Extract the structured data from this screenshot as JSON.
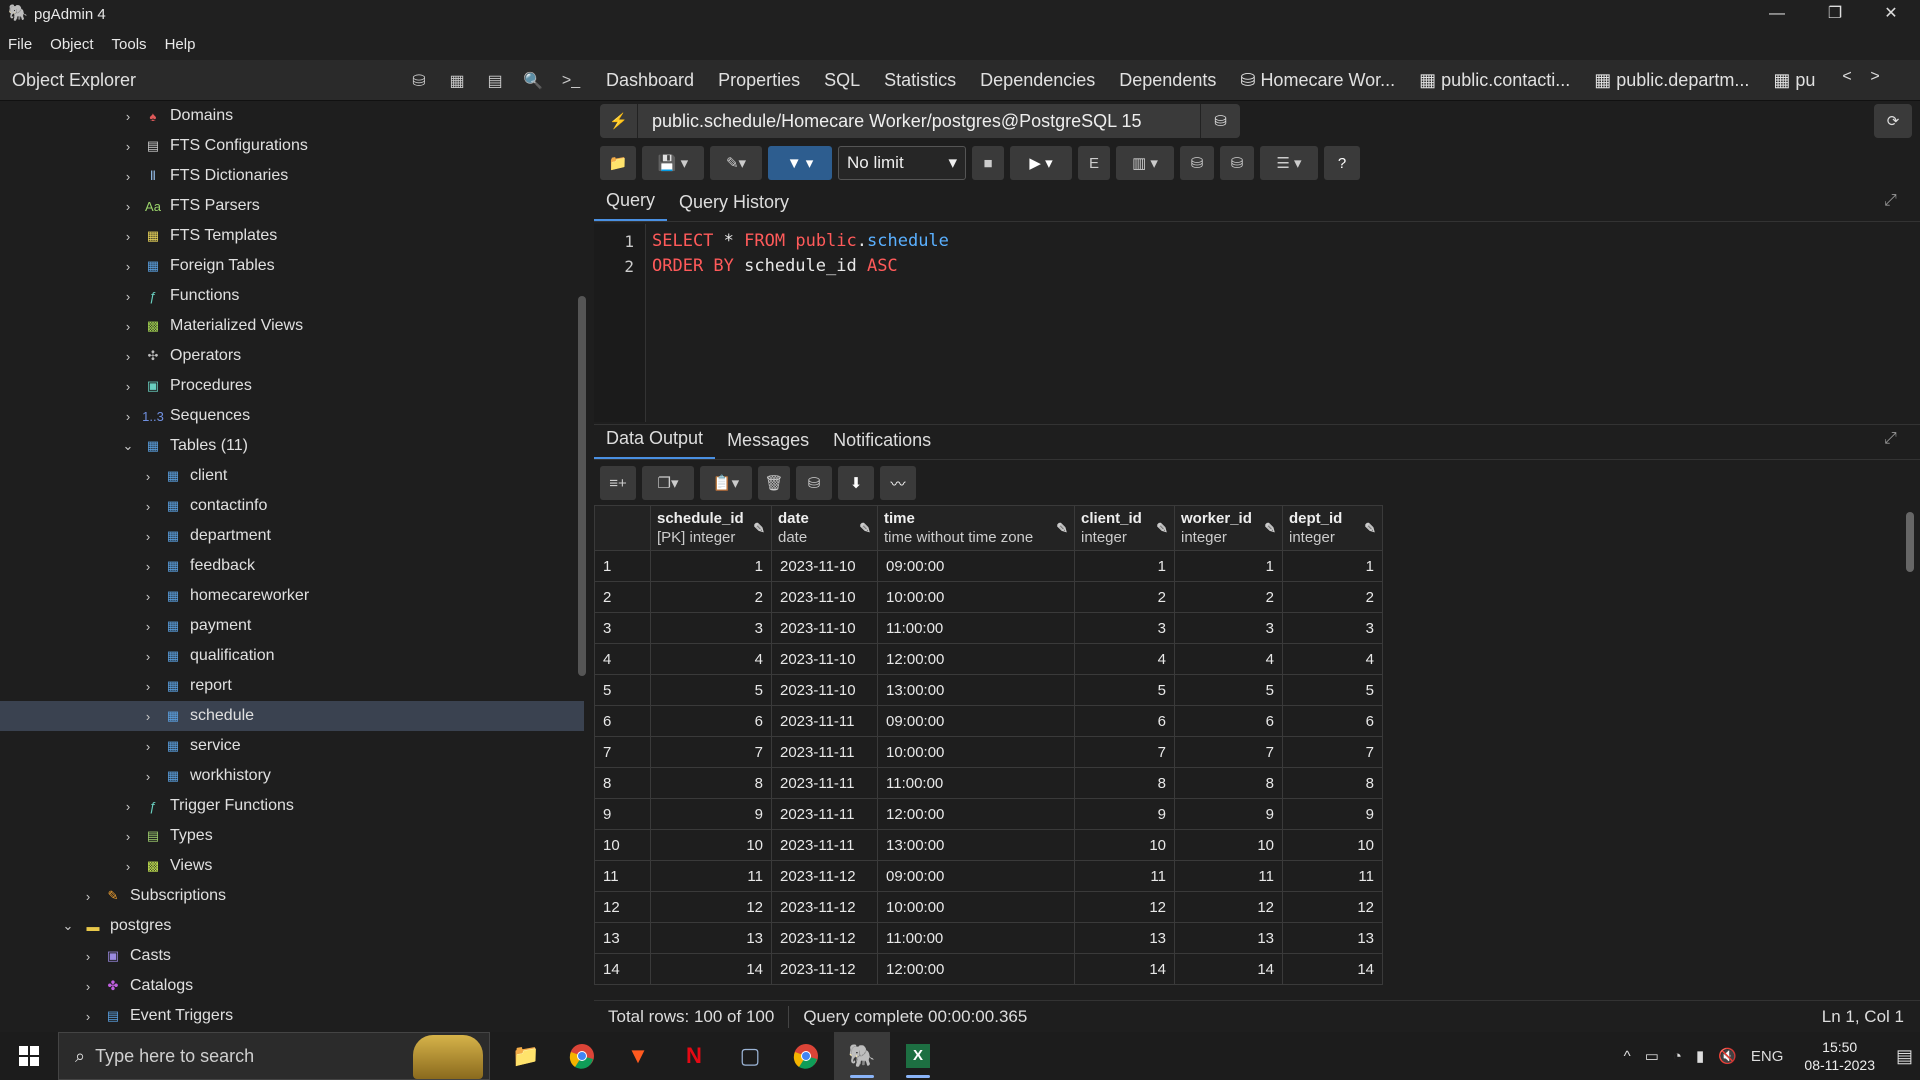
{
  "window": {
    "title": "pgAdmin 4"
  },
  "menu": [
    "File",
    "Object",
    "Tools",
    "Help"
  ],
  "object_explorer": {
    "title": "Object Explorer"
  },
  "tree": [
    {
      "label": "Domains",
      "depth": 1,
      "icon": "domains-icon",
      "color": "#e05a5a",
      "glyph": "♠",
      "chev": ">"
    },
    {
      "label": "FTS Configurations",
      "depth": 1,
      "icon": "fts-config-icon",
      "color": "#c9c9c9",
      "glyph": "▤",
      "chev": ">"
    },
    {
      "label": "FTS Dictionaries",
      "depth": 1,
      "icon": "fts-dict-icon",
      "color": "#8fb7e0",
      "glyph": "Ⅱ",
      "chev": ">"
    },
    {
      "label": "FTS Parsers",
      "depth": 1,
      "icon": "fts-parser-icon",
      "color": "#9ad36a",
      "glyph": "Aa",
      "chev": ">"
    },
    {
      "label": "FTS Templates",
      "depth": 1,
      "icon": "fts-template-icon",
      "color": "#e8d45a",
      "glyph": "▦",
      "chev": ">"
    },
    {
      "label": "Foreign Tables",
      "depth": 1,
      "icon": "foreign-table-icon",
      "color": "#5aa0e0",
      "glyph": "▦",
      "chev": ">"
    },
    {
      "label": "Functions",
      "depth": 1,
      "icon": "function-icon",
      "color": "#6ad0c0",
      "glyph": "ƒ",
      "chev": ">"
    },
    {
      "label": "Materialized Views",
      "depth": 1,
      "icon": "matview-icon",
      "color": "#a0d050",
      "glyph": "▩",
      "chev": ">"
    },
    {
      "label": "Operators",
      "depth": 1,
      "icon": "operator-icon",
      "color": "#bbbbbb",
      "glyph": "✣",
      "chev": ">"
    },
    {
      "label": "Procedures",
      "depth": 1,
      "icon": "procedure-icon",
      "color": "#6ad0c0",
      "glyph": "▣",
      "chev": ">"
    },
    {
      "label": "Sequences",
      "depth": 1,
      "icon": "sequence-icon",
      "color": "#7090e0",
      "glyph": "1..3",
      "chev": ">"
    },
    {
      "label": "Tables (11)",
      "depth": 1,
      "icon": "tables-icon",
      "color": "#5aa0e0",
      "glyph": "▦",
      "chev": "v"
    },
    {
      "label": "client",
      "depth": 2,
      "icon": "table-icon",
      "color": "#5aa0e0",
      "glyph": "▦",
      "chev": ">"
    },
    {
      "label": "contactinfo",
      "depth": 2,
      "icon": "table-icon",
      "color": "#5aa0e0",
      "glyph": "▦",
      "chev": ">"
    },
    {
      "label": "department",
      "depth": 2,
      "icon": "table-icon",
      "color": "#5aa0e0",
      "glyph": "▦",
      "chev": ">"
    },
    {
      "label": "feedback",
      "depth": 2,
      "icon": "table-icon",
      "color": "#5aa0e0",
      "glyph": "▦",
      "chev": ">"
    },
    {
      "label": "homecareworker",
      "depth": 2,
      "icon": "table-icon",
      "color": "#5aa0e0",
      "glyph": "▦",
      "chev": ">"
    },
    {
      "label": "payment",
      "depth": 2,
      "icon": "table-icon",
      "color": "#5aa0e0",
      "glyph": "▦",
      "chev": ">"
    },
    {
      "label": "qualification",
      "depth": 2,
      "icon": "table-icon",
      "color": "#5aa0e0",
      "glyph": "▦",
      "chev": ">"
    },
    {
      "label": "report",
      "depth": 2,
      "icon": "table-icon",
      "color": "#5aa0e0",
      "glyph": "▦",
      "chev": ">"
    },
    {
      "label": "schedule",
      "depth": 2,
      "icon": "table-icon",
      "color": "#5aa0e0",
      "glyph": "▦",
      "chev": ">",
      "selected": true
    },
    {
      "label": "service",
      "depth": 2,
      "icon": "table-icon",
      "color": "#5aa0e0",
      "glyph": "▦",
      "chev": ">"
    },
    {
      "label": "workhistory",
      "depth": 2,
      "icon": "table-icon",
      "color": "#5aa0e0",
      "glyph": "▦",
      "chev": ">"
    },
    {
      "label": "Trigger Functions",
      "depth": 1,
      "icon": "trigger-function-icon",
      "color": "#6ad0c0",
      "glyph": "ƒ",
      "chev": ">"
    },
    {
      "label": "Types",
      "depth": 1,
      "icon": "types-icon",
      "color": "#a0d070",
      "glyph": "▤",
      "chev": ">"
    },
    {
      "label": "Views",
      "depth": 1,
      "icon": "views-icon",
      "color": "#c0e050",
      "glyph": "▩",
      "chev": ">"
    },
    {
      "label": "Subscriptions",
      "depth": 0,
      "icon": "subscription-icon",
      "color": "#f0a030",
      "glyph": "✎",
      "chev": ">"
    },
    {
      "label": "postgres",
      "depth": -1,
      "icon": "database-icon",
      "color": "#e8c84a",
      "glyph": "▬",
      "chev": "v"
    },
    {
      "label": "Casts",
      "depth": 0,
      "icon": "cast-icon",
      "color": "#9a8ae0",
      "glyph": "▣",
      "chev": ">"
    },
    {
      "label": "Catalogs",
      "depth": 0,
      "icon": "catalog-icon",
      "color": "#c060e0",
      "glyph": "✤",
      "chev": ">"
    },
    {
      "label": "Event Triggers",
      "depth": 0,
      "icon": "event-trigger-icon",
      "color": "#5aa0e0",
      "glyph": "▤",
      "chev": ">"
    }
  ],
  "tabs": [
    "Dashboard",
    "Properties",
    "SQL",
    "Statistics",
    "Dependencies",
    "Dependents",
    "Homecare Wor...",
    "public.contacti...",
    "public.departm...",
    "pu"
  ],
  "connection": {
    "label": "public.schedule/Homecare Worker/postgres@PostgreSQL 15"
  },
  "query_toolbar": {
    "limit": "No limit"
  },
  "query_tabs": [
    "Query",
    "Query History"
  ],
  "editor": {
    "lines": [
      "1",
      "2"
    ]
  },
  "output_tabs": [
    "Data Output",
    "Messages",
    "Notifications"
  ],
  "grid": {
    "columns": [
      {
        "name": "schedule_id",
        "type": "[PK] integer"
      },
      {
        "name": "date",
        "type": "date"
      },
      {
        "name": "time",
        "type": "time without time zone"
      },
      {
        "name": "client_id",
        "type": "integer"
      },
      {
        "name": "worker_id",
        "type": "integer"
      },
      {
        "name": "dept_id",
        "type": "integer"
      }
    ],
    "rows": [
      [
        "1",
        "1",
        "2023-11-10",
        "09:00:00",
        "1",
        "1",
        "1"
      ],
      [
        "2",
        "2",
        "2023-11-10",
        "10:00:00",
        "2",
        "2",
        "2"
      ],
      [
        "3",
        "3",
        "2023-11-10",
        "11:00:00",
        "3",
        "3",
        "3"
      ],
      [
        "4",
        "4",
        "2023-11-10",
        "12:00:00",
        "4",
        "4",
        "4"
      ],
      [
        "5",
        "5",
        "2023-11-10",
        "13:00:00",
        "5",
        "5",
        "5"
      ],
      [
        "6",
        "6",
        "2023-11-11",
        "09:00:00",
        "6",
        "6",
        "6"
      ],
      [
        "7",
        "7",
        "2023-11-11",
        "10:00:00",
        "7",
        "7",
        "7"
      ],
      [
        "8",
        "8",
        "2023-11-11",
        "11:00:00",
        "8",
        "8",
        "8"
      ],
      [
        "9",
        "9",
        "2023-11-11",
        "12:00:00",
        "9",
        "9",
        "9"
      ],
      [
        "10",
        "10",
        "2023-11-11",
        "13:00:00",
        "10",
        "10",
        "10"
      ],
      [
        "11",
        "11",
        "2023-11-12",
        "09:00:00",
        "11",
        "11",
        "11"
      ],
      [
        "12",
        "12",
        "2023-11-12",
        "10:00:00",
        "12",
        "12",
        "12"
      ],
      [
        "13",
        "13",
        "2023-11-12",
        "11:00:00",
        "13",
        "13",
        "13"
      ],
      [
        "14",
        "14",
        "2023-11-12",
        "12:00:00",
        "14",
        "14",
        "14"
      ]
    ]
  },
  "status": {
    "rows": "Total rows: 100 of 100",
    "query": "Query complete 00:00:00.365",
    "position": "Ln 1, Col 1"
  },
  "taskbar": {
    "search_placeholder": "Type here to search",
    "lang": "ENG",
    "time": "15:50",
    "date": "08-11-2023"
  }
}
